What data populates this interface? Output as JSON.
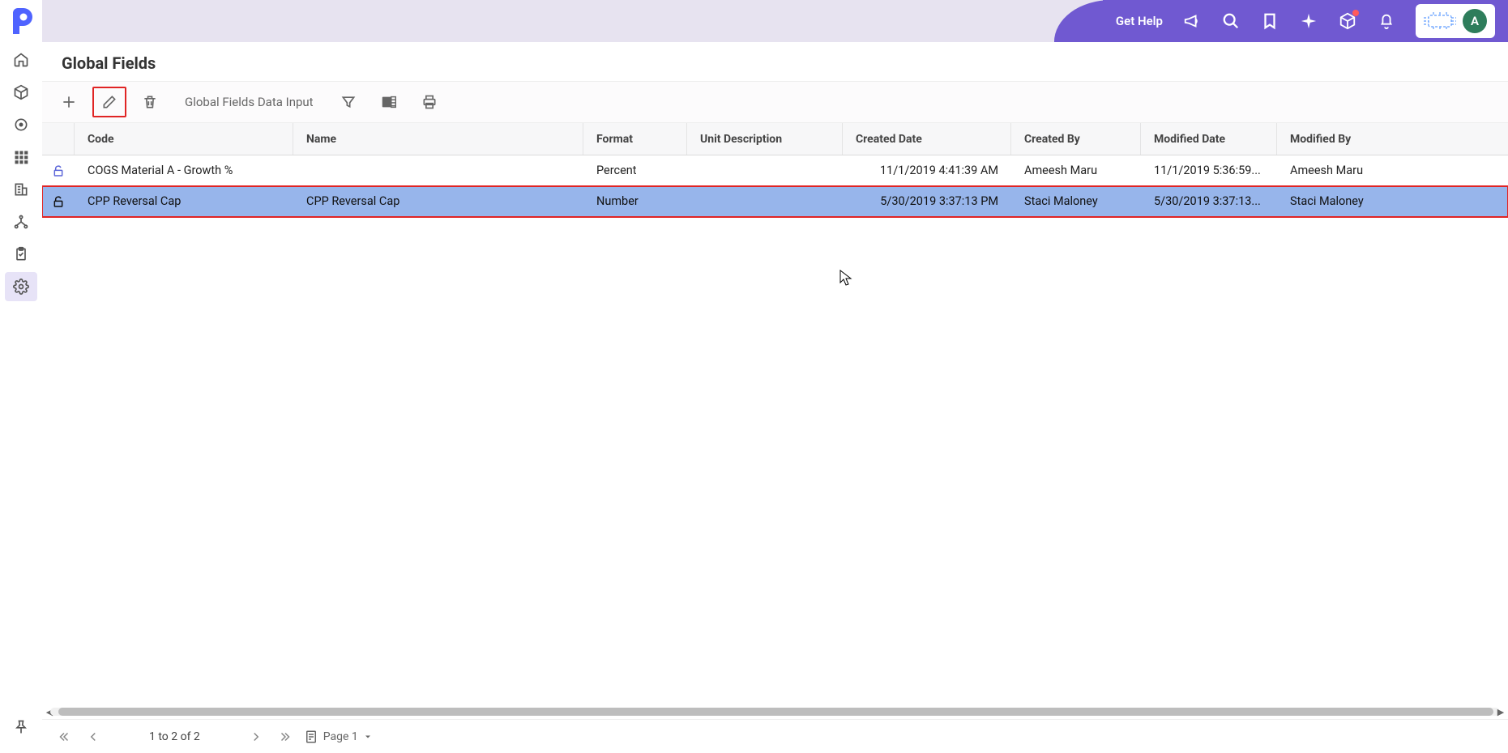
{
  "topbar": {
    "gethelp_label": "Get Help",
    "avatar_initial": "A"
  },
  "page": {
    "title": "Global Fields"
  },
  "toolbar": {
    "data_input_label": "Global Fields Data Input"
  },
  "table": {
    "columns": {
      "code": "Code",
      "name": "Name",
      "format": "Format",
      "unit_description": "Unit Description",
      "created_date": "Created Date",
      "created_by": "Created By",
      "modified_date": "Modified Date",
      "modified_by": "Modified By"
    },
    "rows": [
      {
        "code": "COGS Material A - Growth %",
        "name": "",
        "format": "Percent",
        "unit_description": "",
        "created_date": "11/1/2019 4:41:39 AM",
        "created_by": "Ameesh Maru",
        "modified_date": "11/1/2019 5:36:59...",
        "modified_by": "Ameesh Maru",
        "locked": true,
        "selected": false
      },
      {
        "code": "CPP Reversal Cap",
        "name": "CPP Reversal Cap",
        "format": "Number",
        "unit_description": "",
        "created_date": "5/30/2019 3:37:13 PM",
        "created_by": "Staci Maloney",
        "modified_date": "5/30/2019 3:37:13...",
        "modified_by": "Staci Maloney",
        "locked": true,
        "selected": true
      }
    ]
  },
  "pager": {
    "count_text": "1 to 2 of 2",
    "page_label": "Page 1"
  }
}
